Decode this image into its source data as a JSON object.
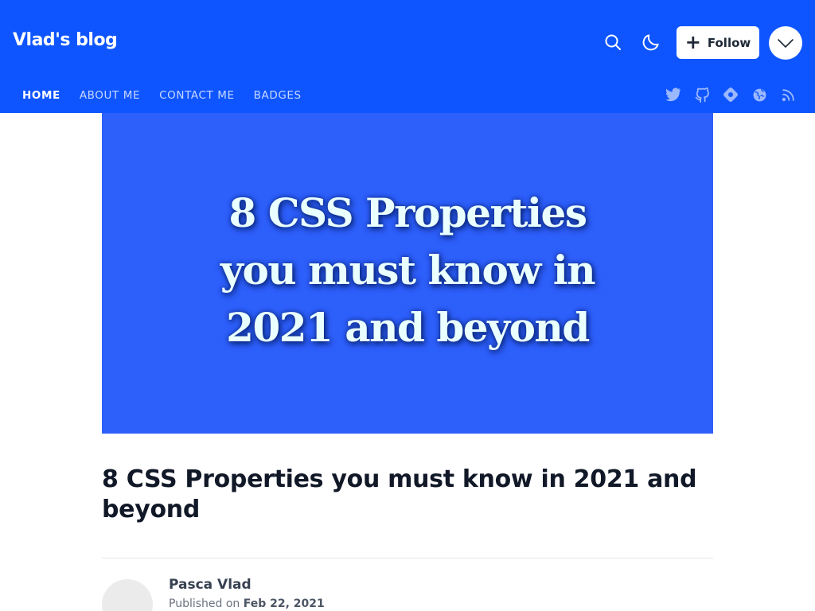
{
  "header": {
    "brand": "Vlad's blog",
    "follow_label": "Follow",
    "icons": {
      "search": "search-icon",
      "theme": "moon-icon",
      "menu": "chevron-down-icon"
    },
    "colors": {
      "background": "#0f55ff"
    }
  },
  "nav": {
    "items": [
      {
        "label": "HOME",
        "active": true
      },
      {
        "label": "ABOUT ME",
        "active": false
      },
      {
        "label": "CONTACT ME",
        "active": false
      },
      {
        "label": "BADGES",
        "active": false
      }
    ]
  },
  "social": [
    "twitter-icon",
    "github-icon",
    "hashnode-icon",
    "globe-icon",
    "rss-icon"
  ],
  "cover": {
    "line1": "8 CSS Properties",
    "line2": "you must know in",
    "line3": "2021 and beyond",
    "background": "#2d5ffb"
  },
  "post": {
    "title": "8 CSS Properties you must know in 2021 and beyond",
    "author": "Pasca Vlad",
    "published_prefix": "Published on",
    "published_date": "Feb 22, 2021"
  }
}
